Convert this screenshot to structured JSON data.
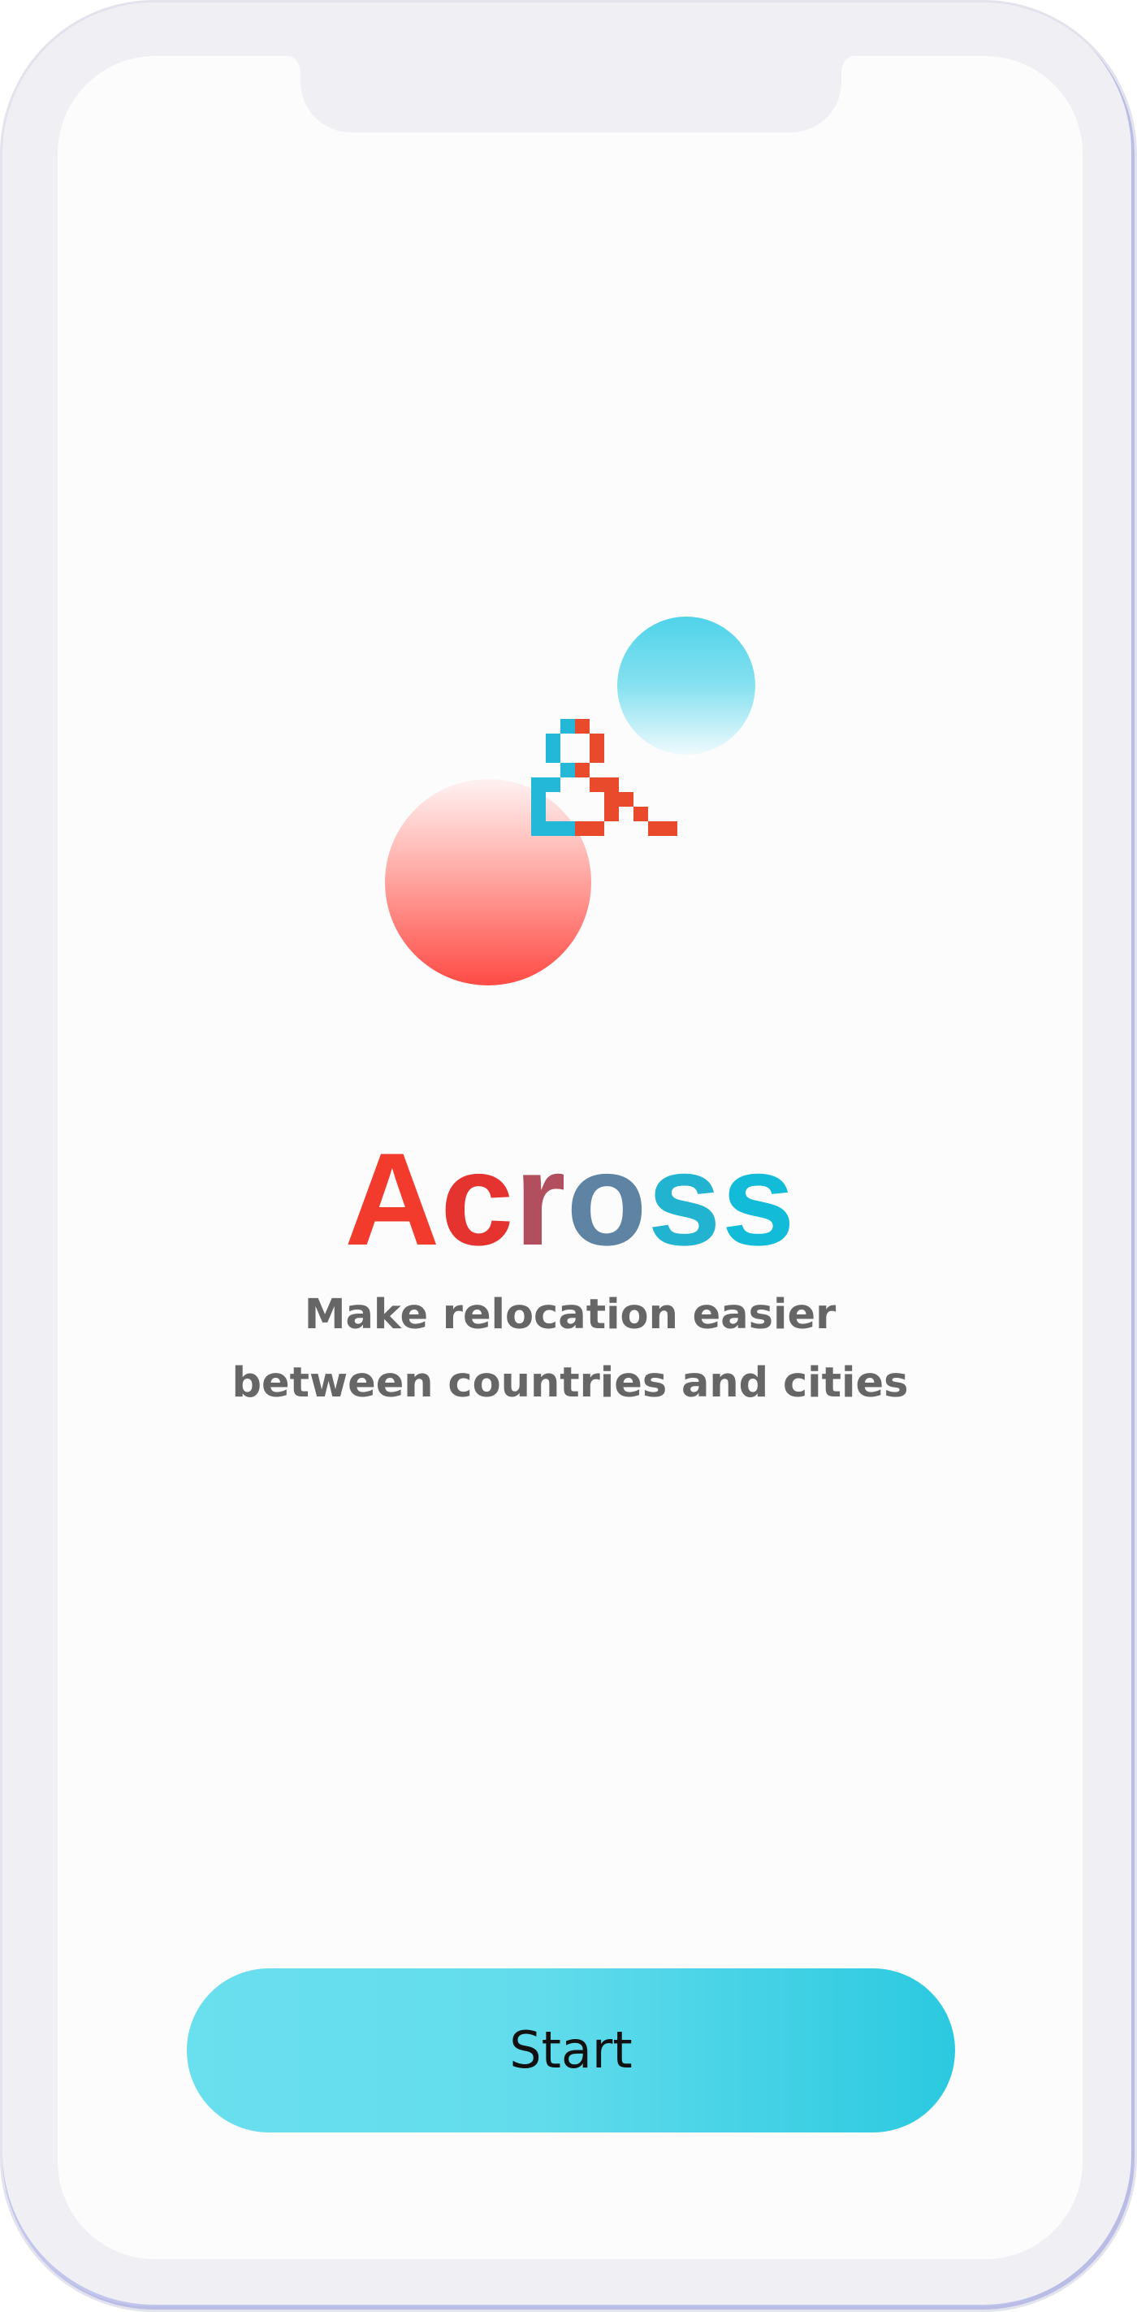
{
  "app": {
    "title_letters": [
      {
        "char": "A",
        "color": "#f23b2c"
      },
      {
        "char": "c",
        "color": "#e5332f"
      },
      {
        "char": "r",
        "color": "#b24f5e"
      },
      {
        "char": "o",
        "color": "#5f84a3"
      },
      {
        "char": "s",
        "color": "#21b3cf"
      },
      {
        "char": "s",
        "color": "#12bcd9"
      }
    ],
    "tagline_line1": "Make relocation easier",
    "tagline_line2": "between countries and cities"
  },
  "actions": {
    "start_label": "Start"
  },
  "colors": {
    "accent_blue": "#2bc9e0",
    "accent_red": "#ff4b45",
    "logo_red": "#e84a2b",
    "logo_blue": "#24b8d8",
    "text_gray": "#666666",
    "frame": "#efeff4"
  },
  "icons": {
    "logo": "across-pixel-logo-icon",
    "bubble_blue": "blue-bubble-icon",
    "bubble_red": "red-bubble-icon"
  }
}
